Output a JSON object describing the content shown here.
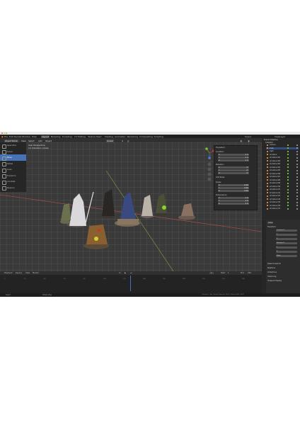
{
  "menu": {
    "items": [
      "File",
      "Edit",
      "Render",
      "Window",
      "Help"
    ],
    "workspaces": [
      "Layout",
      "Modeling",
      "Sculpting",
      "UV Editing",
      "Texture Paint",
      "Shading",
      "Animation",
      "Rendering",
      "Compositing",
      "Scripting"
    ],
    "active_workspace": "Layout",
    "scene": "Scene",
    "view_layer": "ViewLayer"
  },
  "header": {
    "mode": "Object Mode",
    "view": "View",
    "select": "Select",
    "add": "Add",
    "object": "Object",
    "transform": "Global"
  },
  "viewport": {
    "overlay_title": "User Perspective",
    "overlay_subtitle": "(1) Collection | Cube"
  },
  "toolbar": {
    "tools": [
      "Select Box",
      "Cursor",
      "Move",
      "Rotate",
      "Scale",
      "Transform",
      "Annotate",
      "Measure"
    ],
    "active_index": 2
  },
  "npanel": {
    "title": "Transform",
    "location_label": "Location:",
    "location": [
      {
        "axis": "X",
        "value": "0 m"
      },
      {
        "axis": "Y",
        "value": "0 m"
      },
      {
        "axis": "Z",
        "value": "0 m"
      }
    ],
    "rotation_label": "Rotation:",
    "rotation": [
      {
        "axis": "X",
        "value": "0°"
      },
      {
        "axis": "Y",
        "value": "0°"
      },
      {
        "axis": "Z",
        "value": "0°"
      }
    ],
    "mode_label": "XYZ Euler",
    "scale_label": "Scale:",
    "scale": [
      {
        "axis": "X",
        "value": "1.000"
      },
      {
        "axis": "Y",
        "value": "1.000"
      },
      {
        "axis": "Z",
        "value": "1.000"
      }
    ],
    "dimensions_label": "Dimensions:",
    "dimensions": [
      {
        "axis": "X",
        "value": "2 m"
      },
      {
        "axis": "Y",
        "value": "2 m"
      },
      {
        "axis": "Z",
        "value": "2 m"
      }
    ]
  },
  "outliner": {
    "title": "Scene Collection",
    "collection": "Collection",
    "items": [
      "Camera",
      "Cube",
      "Light",
      "Armature",
      "Armature.001",
      "Armature.002",
      "Armature.003",
      "Armature.004",
      "Armature.005",
      "Armature.006",
      "Armature.007",
      "Armature.008",
      "Armature.009",
      "Armature.010",
      "Armature.011",
      "Armature.012",
      "Armature.013",
      "Armature.014",
      "Armature.015",
      "Armature.016",
      "Armature.017"
    ],
    "selected_index": 1
  },
  "properties": {
    "object_name": "Cube",
    "section": "Transform",
    "fields": [
      "Location X",
      "Y",
      "Z",
      "Rotation X",
      "Y",
      "Z",
      "Mode"
    ],
    "delta": "Delta Transform",
    "relations": "Relations",
    "collections": "Collections",
    "instancing": "Instancing",
    "viewport_display": "Viewport Display"
  },
  "timeline": {
    "menu": [
      "Playback",
      "Keying",
      "View",
      "Marker"
    ],
    "start_label": "Start",
    "start": "1",
    "end_label": "End",
    "end": "250",
    "current": "1",
    "ticks": [
      "0",
      "20",
      "40",
      "60",
      "80",
      "100",
      "120",
      "140",
      "160",
      "180",
      "200",
      "220",
      "240"
    ]
  },
  "status": {
    "left": "Select",
    "middle": "Rotate View",
    "right": "Collection | Cube | Verts:8 | Faces:6 | Tris:12 | Objects:1/40 | 2.82.7"
  },
  "colors": {
    "accent": "#4772b3",
    "object_orange": "#e08a3c",
    "x_axis": "#d04040",
    "y_axis": "#7fbf3f",
    "z_axis": "#4c7fd9"
  }
}
